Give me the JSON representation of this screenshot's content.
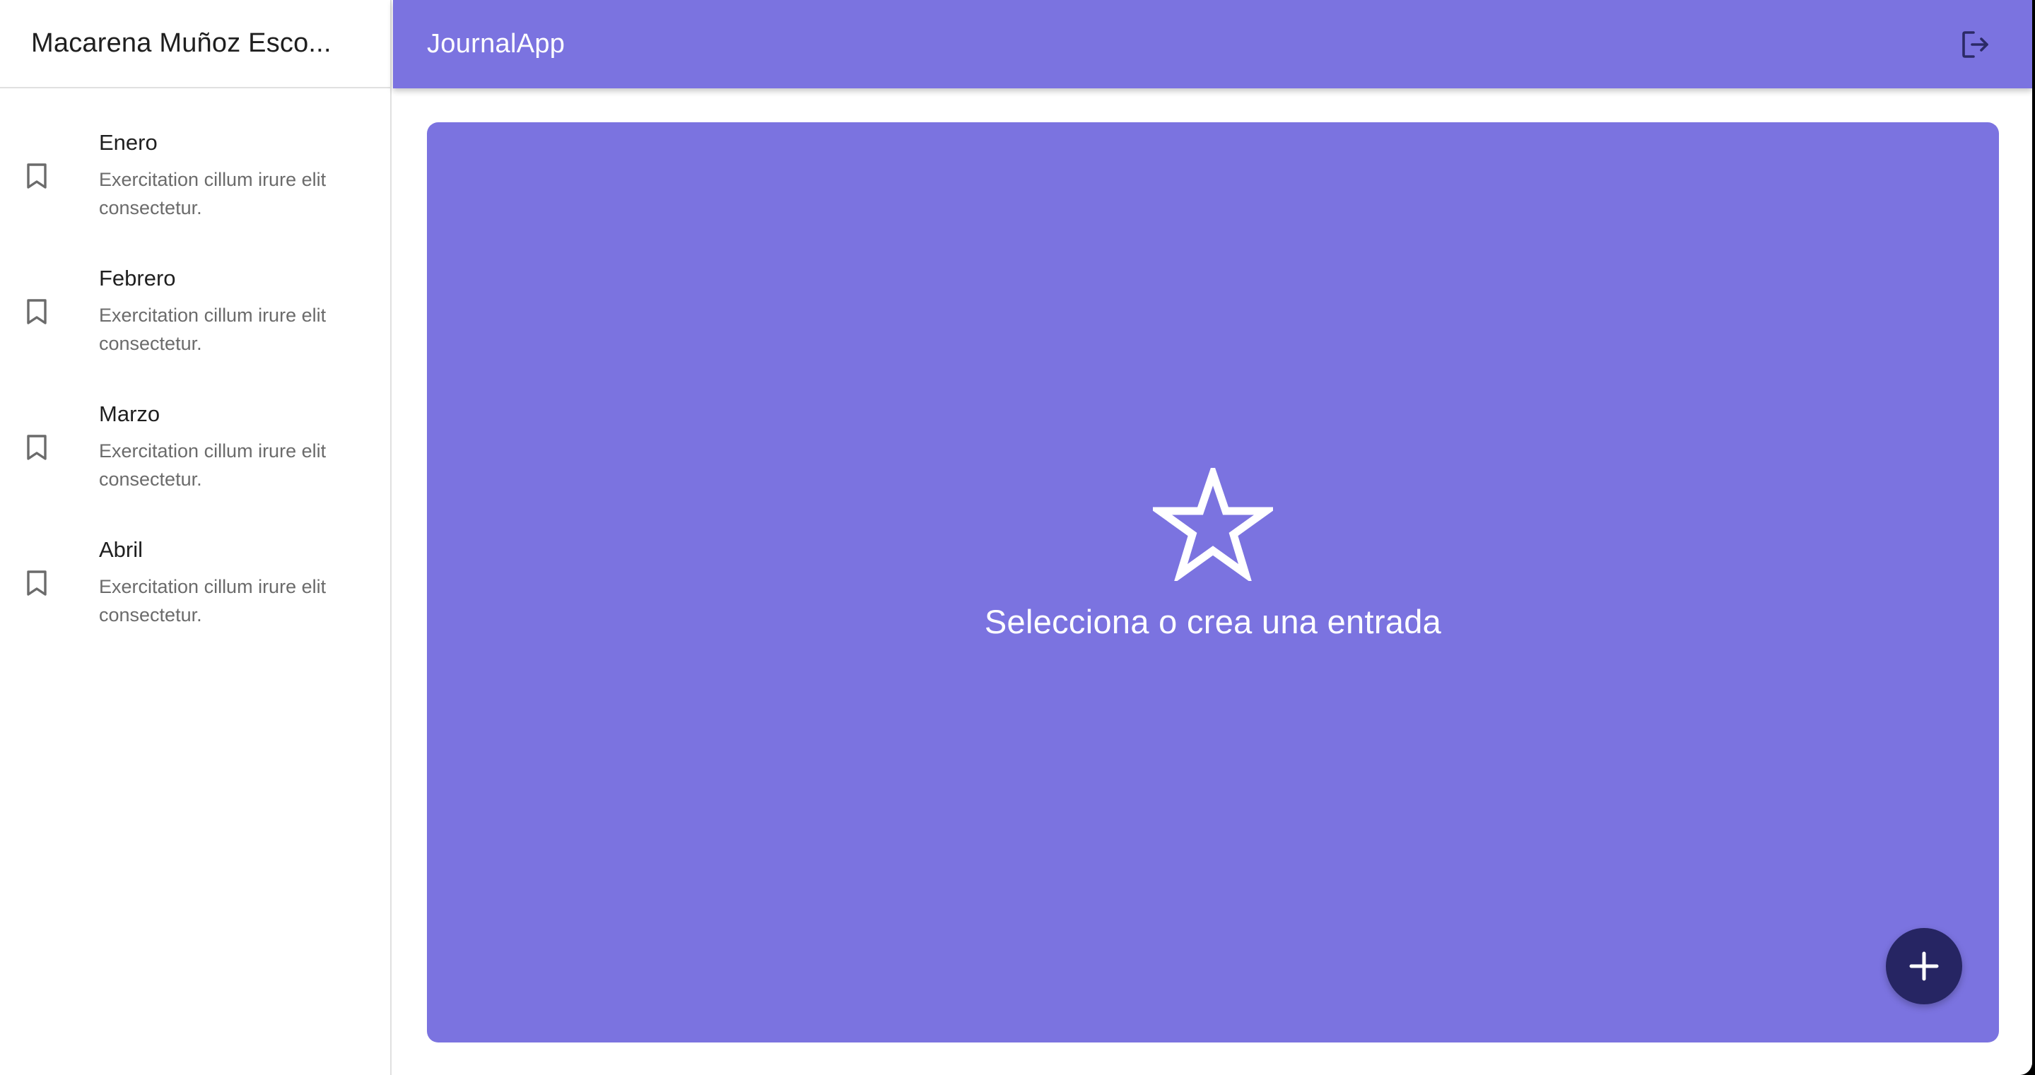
{
  "sidebar": {
    "user_name": "Macarena Muñoz Esco...",
    "entries": [
      {
        "title": "Enero",
        "body": "Exercitation cillum irure elit consectetur.",
        "icon": "bookmark-icon"
      },
      {
        "title": "Febrero",
        "body": "Exercitation cillum irure elit consectetur.",
        "icon": "bookmark-icon"
      },
      {
        "title": "Marzo",
        "body": "Exercitation cillum irure elit consectetur.",
        "icon": "bookmark-icon"
      },
      {
        "title": "Abril",
        "body": "Exercitation cillum irure elit consectetur.",
        "icon": "bookmark-icon"
      }
    ]
  },
  "appbar": {
    "title": "JournalApp",
    "logout_icon": "logout-icon"
  },
  "main": {
    "empty_icon": "star-outline-icon",
    "empty_message": "Selecciona o crea una entrada",
    "fab_icon": "plus-icon"
  },
  "colors": {
    "primary": "#7b73e0",
    "fab": "#262563",
    "text_primary": "#1f1f1f",
    "text_secondary": "#6b6b6b"
  }
}
